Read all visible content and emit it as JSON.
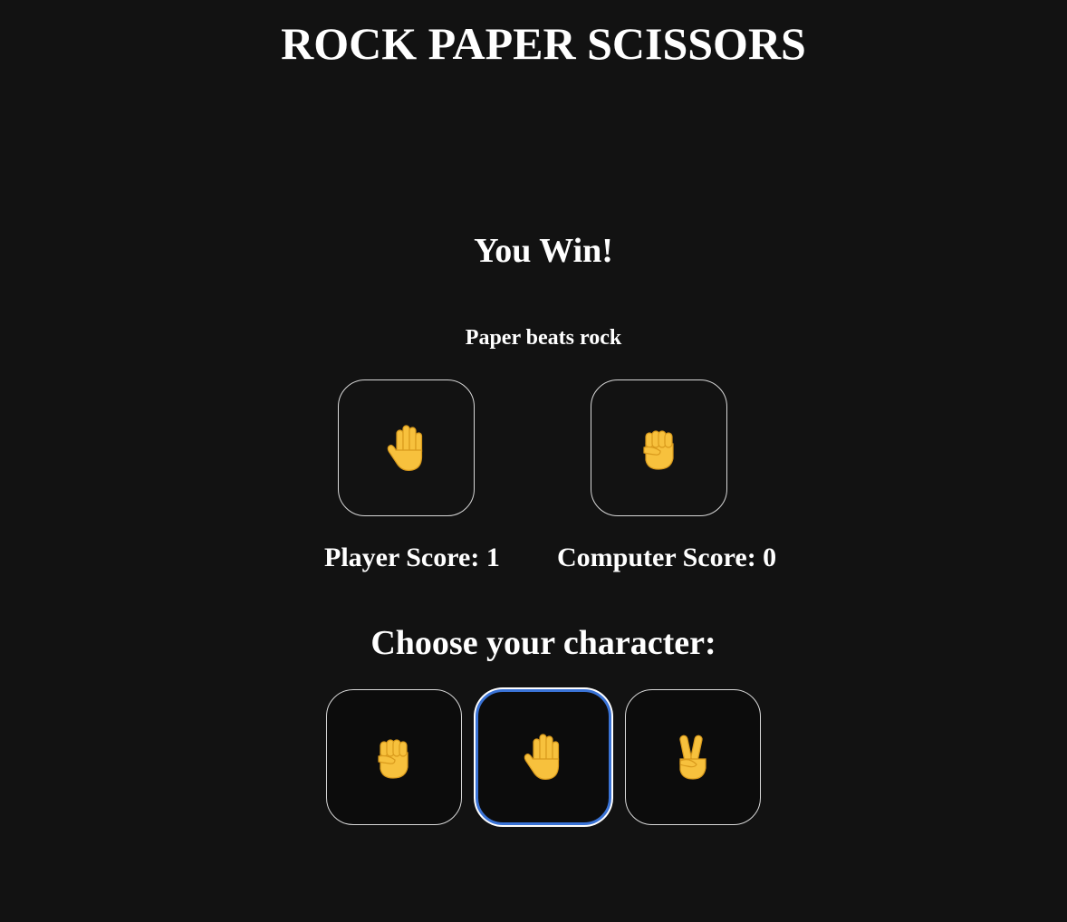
{
  "game": {
    "title": "ROCK PAPER SCISSORS",
    "result": "You Win!",
    "explanation": "Paper beats rock"
  },
  "round": {
    "player_choice_icon": "raised-hand-icon",
    "computer_choice_icon": "raised-fist-icon"
  },
  "scores": {
    "player": "Player Score: 1",
    "computer": "Computer Score: 0"
  },
  "selector": {
    "heading": "Choose your character:",
    "options": [
      {
        "id": "rock",
        "icon": "raised-fist-icon"
      },
      {
        "id": "paper",
        "icon": "raised-hand-icon",
        "focused": true
      },
      {
        "id": "scissors",
        "icon": "victory-hand-icon"
      }
    ]
  },
  "colors": {
    "background": "#121212",
    "text": "#ffffff",
    "border": "#d8d8d8",
    "focus_ring": "#3a73d6",
    "emoji_skin": "#f7c13d"
  }
}
